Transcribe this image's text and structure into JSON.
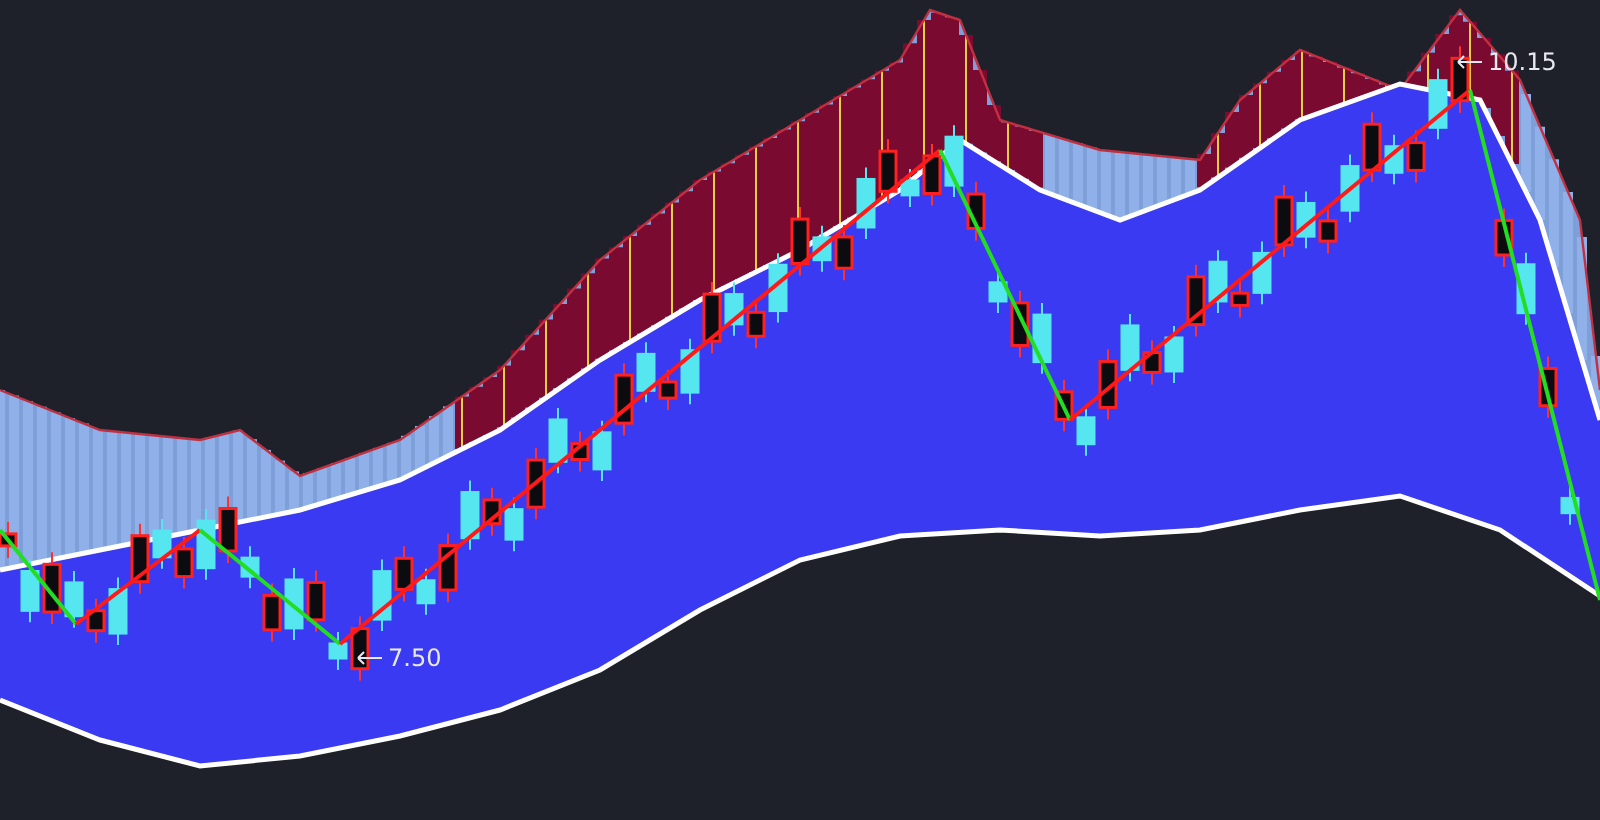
{
  "chart": {
    "annotations": [
      {
        "kind": "high",
        "text": "10.15"
      },
      {
        "kind": "low",
        "text": "7.50"
      }
    ]
  }
}
